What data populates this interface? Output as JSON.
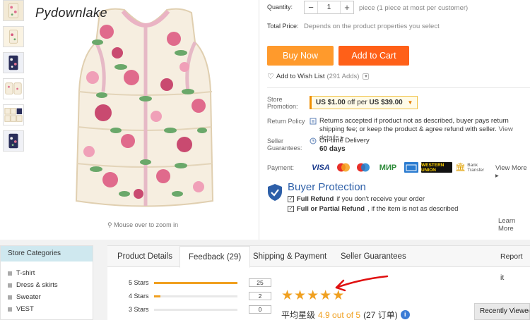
{
  "gallery": {
    "watermark": "Pydownlake",
    "zoom_hint": "Mouse over to zoom in",
    "thumb_count": 6
  },
  "quantity": {
    "label": "Quantity:",
    "value": "1",
    "minus": "−",
    "plus": "+",
    "note": "piece (1 piece at most per customer)"
  },
  "total_price": {
    "label": "Total Price:",
    "value": "Depends on the product properties you select"
  },
  "buttons": {
    "buy_now": "Buy Now",
    "add_to_cart": "Add to Cart"
  },
  "wishlist": {
    "label": "Add to Wish List",
    "adds": "(291 Adds)"
  },
  "store_promotion": {
    "label_line1": "Store",
    "label_line2": "Promotion:",
    "prefix": "US $1.00",
    "middle": "off per",
    "suffix": "US $39.00"
  },
  "return_policy": {
    "label": "Return Policy",
    "text": "Returns accepted if product not as described, buyer pays return shipping fee; or keep the product & agree refund with seller.",
    "link": "View details ▸"
  },
  "seller_guarantees": {
    "label_line1": "Seller",
    "label_line2": "Guarantees:",
    "ontime": "On-time Delivery",
    "days": "60 days"
  },
  "payment": {
    "label": "Payment:",
    "methods": [
      "VISA",
      "MasterCard",
      "Maestro",
      "МИР",
      "AmEx",
      "WESTERN UNION",
      "Bank Transfer"
    ],
    "view_more": "View More ▸"
  },
  "buyer_protection": {
    "title": "Buyer Protection",
    "line1_bold": "Full Refund",
    "line1_rest": "if you don't receive your order",
    "line2_bold": "Full or Partial Refund",
    "line2_rest": ", if the item is not as described",
    "learn_more": "Learn More"
  },
  "store_categories": {
    "title": "Store Categories",
    "items": [
      "T-shirt",
      "Dress & skirts",
      "Sweater",
      "VEST"
    ]
  },
  "tabs": {
    "items": [
      "Product Details",
      "Feedback (29)",
      "Shipping & Payment",
      "Seller Guarantees"
    ],
    "active": 1,
    "report": "Report it"
  },
  "feedback": {
    "rows": [
      {
        "label": "5 Stars",
        "count": "25",
        "fraction": 1.0
      },
      {
        "label": "4 Stars",
        "count": "2",
        "fraction": 0.08
      },
      {
        "label": "3 Stars",
        "count": "0",
        "fraction": 0.0
      }
    ],
    "stars": 5,
    "rating_prefix": "平均星级",
    "rating_value": "4.9 out of 5",
    "rating_count": "(27 订单)"
  },
  "recently_viewed": "Recently Viewed",
  "colors": {
    "buy_now": "#ff9a2c",
    "add_to_cart": "#ff6018",
    "star": "#f0a020",
    "annotation_arrow": "#e01010",
    "buyer_protection": "#2d5fa8"
  }
}
